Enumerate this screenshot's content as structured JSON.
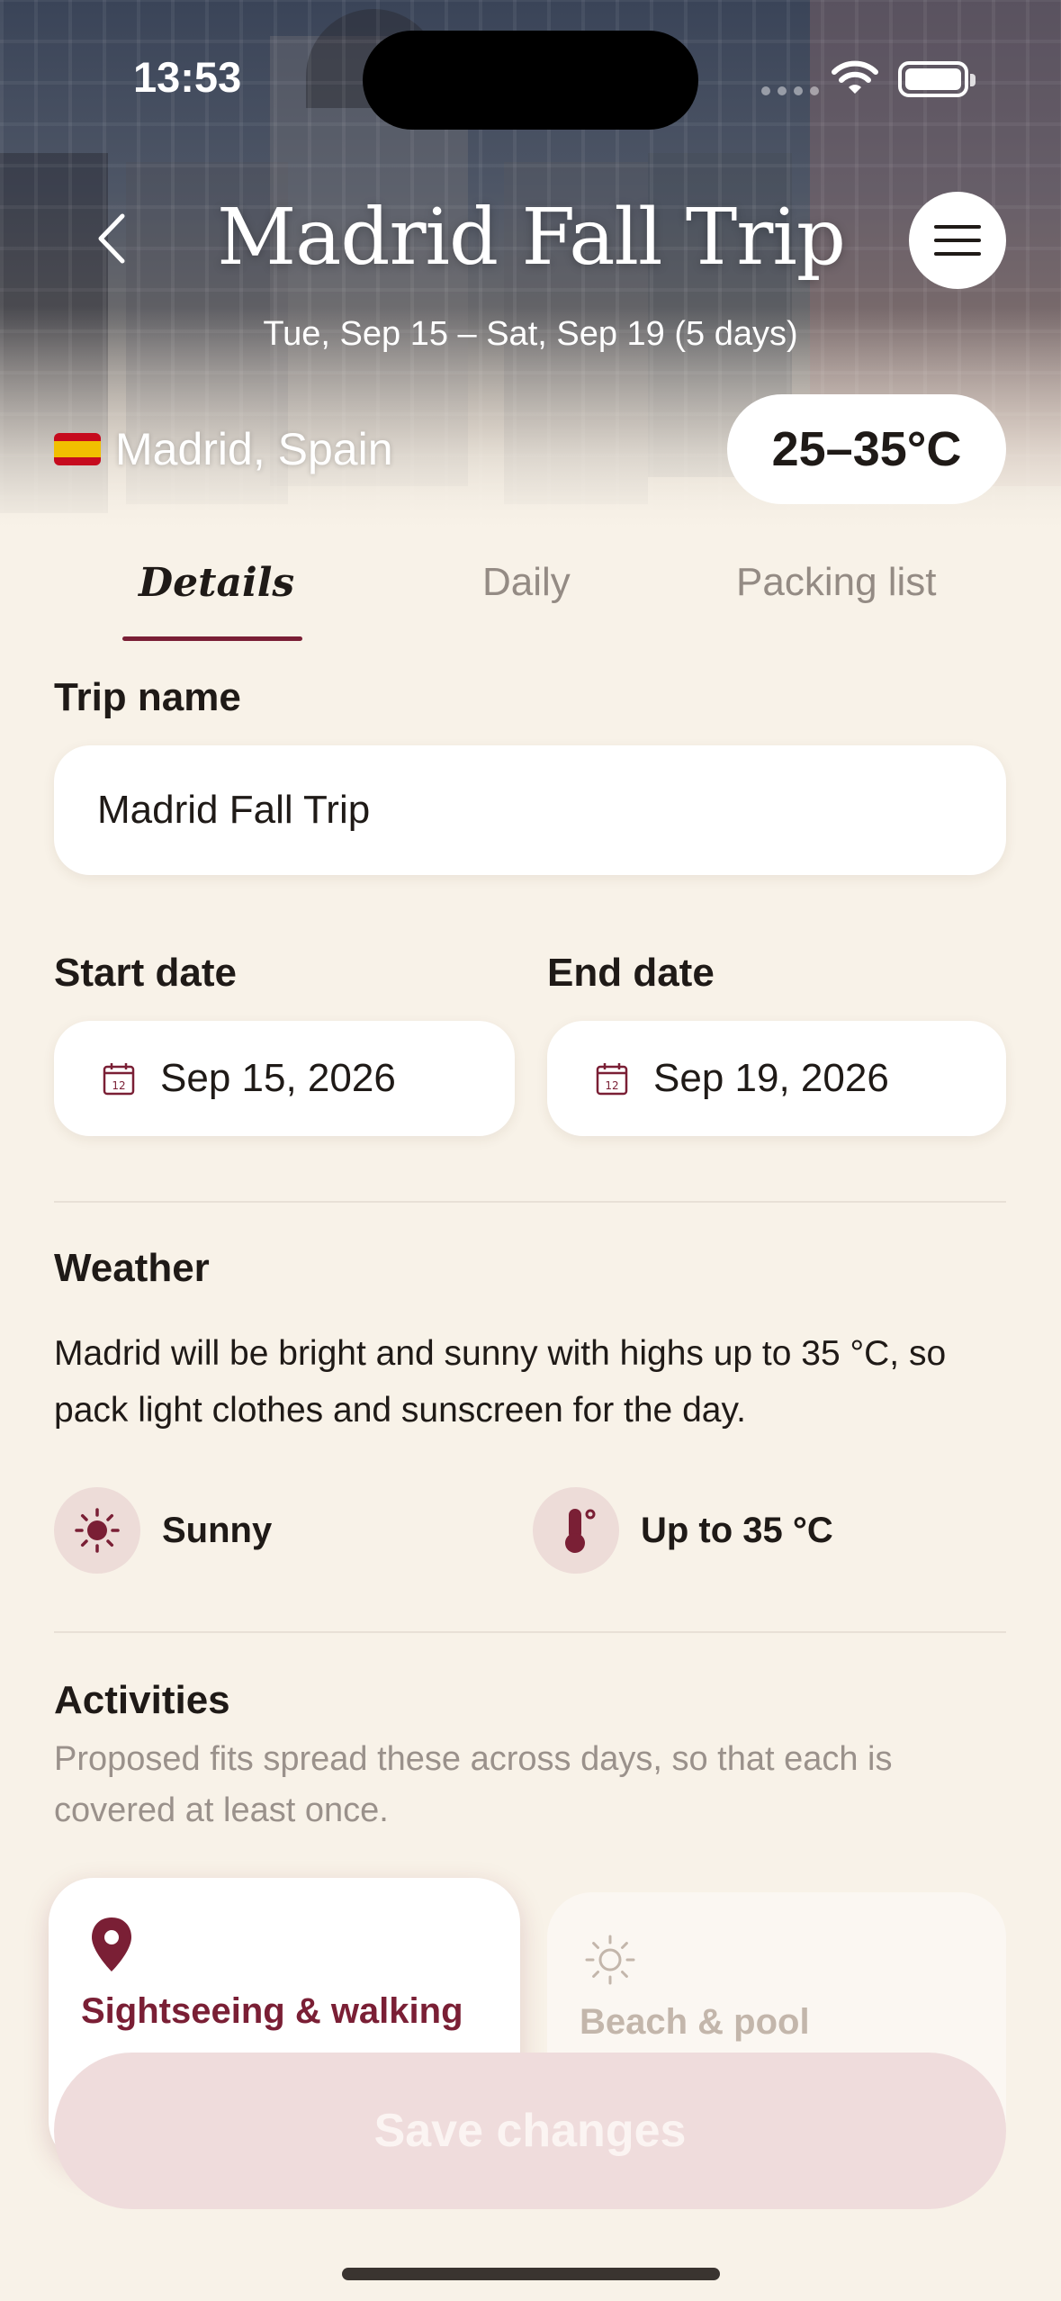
{
  "status_bar": {
    "time": "13:53"
  },
  "header": {
    "title": "Madrid Fall Trip",
    "dates": "Tue, Sep 15 – Sat, Sep 19 (5 days)",
    "location": "Madrid, Spain",
    "temperature": "25–35°C"
  },
  "tabs": [
    {
      "label": "Details",
      "active": true
    },
    {
      "label": "Daily",
      "active": false
    },
    {
      "label": "Packing list",
      "active": false
    }
  ],
  "form": {
    "trip_name_label": "Trip name",
    "trip_name_value": "Madrid Fall Trip",
    "start_date_label": "Start date",
    "start_date_value": "Sep 15, 2026",
    "end_date_label": "End date",
    "end_date_value": "Sep 19, 2026",
    "calendar_icon_day": "12"
  },
  "weather": {
    "heading": "Weather",
    "description": "Madrid will be bright and sunny with highs up to 35 °C, so pack light clothes and sunscreen for the day.",
    "chips": [
      {
        "icon": "sun-icon",
        "label": "Sunny"
      },
      {
        "icon": "thermometer-icon",
        "label": "Up to 35 °C"
      }
    ]
  },
  "activities": {
    "heading": "Activities",
    "subtext": "Proposed fits spread these across days, so that each is covered at least once.",
    "items": [
      {
        "icon": "map-pin-icon",
        "label": "Sightseeing & walking",
        "selected": true
      },
      {
        "icon": "sun-outline-icon",
        "label": "Beach & pool",
        "selected": false
      }
    ]
  },
  "actions": {
    "save_label": "Save changes"
  },
  "colors": {
    "accent": "#7a1f35",
    "background": "#f8f2e8",
    "button_disabled": "#efdcdc"
  }
}
